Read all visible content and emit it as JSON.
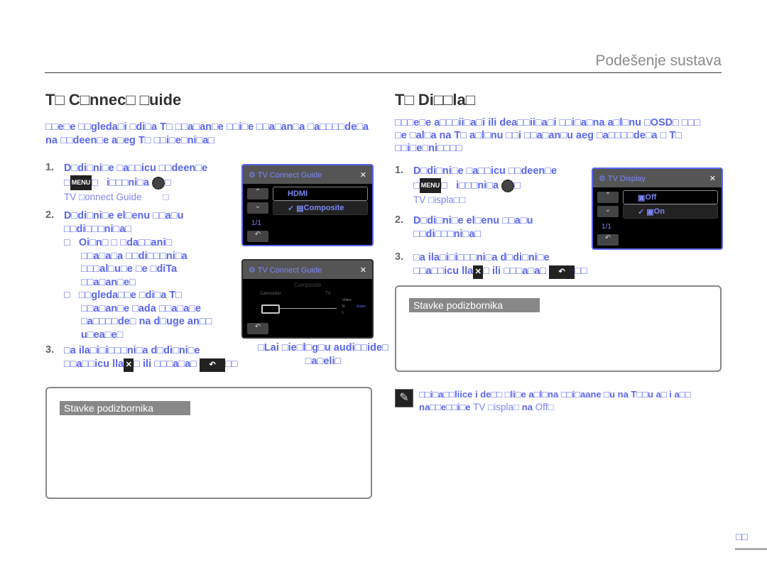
{
  "header": {
    "section": "Podešenje sustava"
  },
  "left": {
    "title": "T□ C□nnec□ □uide",
    "intro": [
      "□□e□e □□gleda□i □di□a T□ □□a□an□e □□i□e □□a□an□a □a□□□□de□a",
      "na □□deen□e a□eg T□ □□i□e□ni□a□"
    ],
    "step1": {
      "num": "1.",
      "line1": "D□di□ni□e □a□□icu □□deen□e",
      "menu": "MENU",
      "line2": "i□□□ni□a",
      "sub": "TV □onnect Guide",
      "sub2": "□"
    },
    "step2": {
      "num": "2.",
      "line1": "D□di□ni□e el□enu □□a□u",
      "line2": "□□di□□□ni□a□"
    },
    "bullets": [
      [
        "Oi□n□ □ □da□□ani□",
        "□□a□a□a □□di□□□ni□a",
        "□□□al□u□e □e □diTa",
        "□□a□an□e□"
      ],
      [
        "□□gleda□□e □di□a T□",
        "□□a□an□e □ada □□a□a□e",
        "□a□□□□de□ na d□uge an□□",
        "u□ea□e□"
      ]
    ],
    "step3": {
      "num": "3.",
      "line1": "□a ila□i□i□□□ni□a d□di□ni□e",
      "line2": "□a□□icu lla",
      "line3": "ili □□□a□a□"
    },
    "caption": [
      "□Lai □ie□l□g□u audi□□ide□",
      "□a□eli□"
    ],
    "submenu": {
      "label": "Stavke podizbornika"
    },
    "lcd1": {
      "title": "TV Connect Guide",
      "opt1": "HDMI",
      "opt2": "Composite",
      "page": "1/1"
    },
    "lcd2": {
      "title": "TV Connect Guide",
      "subtitle": "Composite",
      "cam": "Camcorder",
      "tv": "TV",
      "video": "Video",
      "r": "R",
      "l": "L",
      "audio": "Audio"
    }
  },
  "right": {
    "title": "T□ Di□□la□",
    "intro": [
      "□□□e□e a□□□ii□a□i ili dea□□ii□a□i □□i□a□na a□l□nu □OSD□ □□□",
      "□e □al□a na T□ a□l□nu □□i □□a□an□u aeg □a□□□□de□a □ T□",
      "□□i□e□ni□□□□"
    ],
    "step1": {
      "num": "1.",
      "line1": "D□di□ni□e □a□□icu □□deen□e",
      "menu": "MENU",
      "line2": "i□□□ni□a",
      "sub": "TV □isplа□□"
    },
    "step2": {
      "num": "2.",
      "line1": "D□di□ni□e el□enu □□a□u",
      "line2": "□□di□□□ni□a□"
    },
    "step3": {
      "num": "3.",
      "line1": "□a ila□i□i□□□ni□a d□di□ni□e",
      "line2": "□a□□icu lla",
      "line3": "ili □□□a□a□"
    },
    "submenu": {
      "label": "Stavke podizbornika"
    },
    "lcd": {
      "title": "TV Display",
      "opt1": "Off",
      "opt2": "On",
      "page": "1/1"
    },
    "note": [
      "□□i□a□□liice i de□□ □li□e a□l□na □□i□aane □u na T□□u a□ i a□□",
      "na□□e□□i□e",
      "TV □isplа□",
      "na",
      "Off□"
    ]
  },
  "page_number": "□□"
}
